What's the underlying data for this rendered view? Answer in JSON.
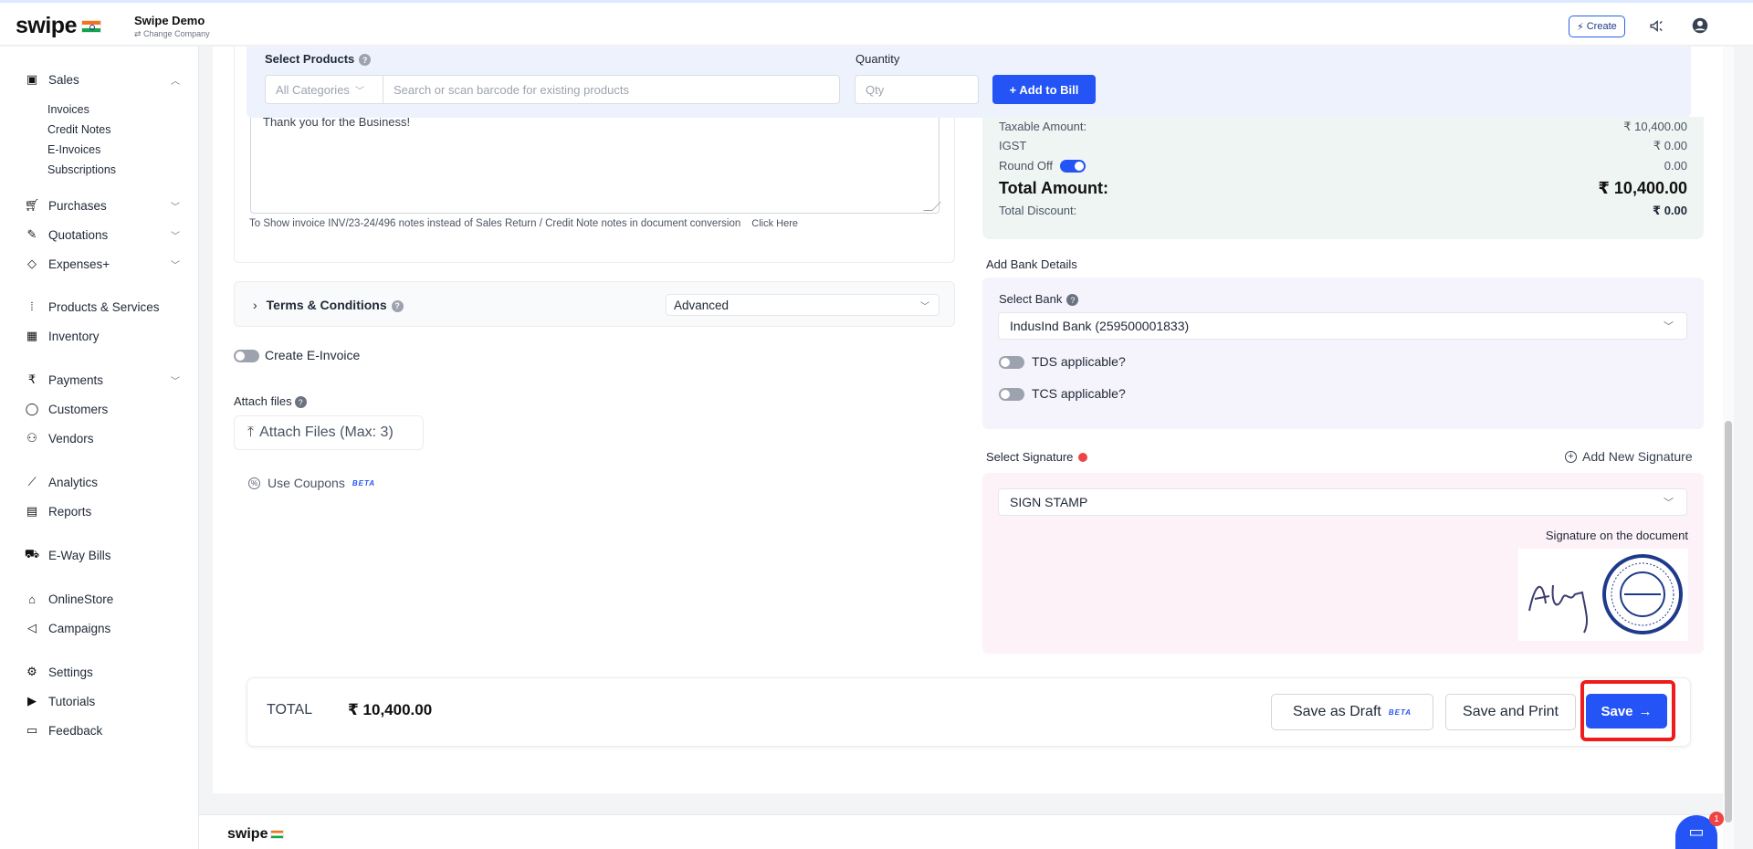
{
  "topbar": {
    "logo": "swipe",
    "company_name": "Swipe Demo",
    "change_company": "Change Company",
    "create_label": "Create"
  },
  "sidebar": {
    "sales": "Sales",
    "sales_sub": [
      "Invoices",
      "Credit Notes",
      "E-Invoices",
      "Subscriptions"
    ],
    "purchases": "Purchases",
    "quotations": "Quotations",
    "expenses": "Expenses+",
    "products": "Products & Services",
    "inventory": "Inventory",
    "payments": "Payments",
    "customers": "Customers",
    "vendors": "Vendors",
    "analytics": "Analytics",
    "reports": "Reports",
    "eway": "E-Way Bills",
    "onlinestore": "OnlineStore",
    "campaigns": "Campaigns",
    "settings": "Settings",
    "tutorials": "Tutorials",
    "feedback": "Feedback"
  },
  "products_bar": {
    "select_label": "Select Products",
    "category_placeholder": "All Categories",
    "search_placeholder": "Search or scan barcode for existing products",
    "quantity_label": "Quantity",
    "qty_placeholder": "Qty",
    "add_button": "+ Add to Bill"
  },
  "notes": {
    "text": "Thank you for the Business!",
    "hint": "To Show invoice INV/23-24/496 notes instead of Sales Return / Credit Note notes in document conversion",
    "click_here": "Click Here"
  },
  "terms": {
    "title": "Terms & Conditions",
    "mode": "Advanced"
  },
  "einvoice": {
    "label": "Create E-Invoice"
  },
  "attach": {
    "label": "Attach files",
    "button": "Attach Files (Max: 3)"
  },
  "coupons": {
    "label": "Use Coupons",
    "beta": "BETA"
  },
  "summary": {
    "taxable_label": "Taxable Amount:",
    "taxable_value": "₹ 10,400.00",
    "igst_label": "IGST",
    "igst_value": "₹ 0.00",
    "roundoff_label": "Round Off",
    "roundoff_value": "0.00",
    "total_label": "Total Amount:",
    "total_value": "₹ 10,400.00",
    "discount_label": "Total Discount:",
    "discount_value": "₹ 0.00"
  },
  "bank": {
    "section_label": "Add Bank Details",
    "select_label": "Select Bank",
    "selected_bank": "IndusInd Bank (259500001833)",
    "tds_label": "TDS applicable?",
    "tcs_label": "TCS applicable?"
  },
  "signature": {
    "section_label": "Select Signature",
    "add_new": "Add New Signature",
    "selected": "SIGN STAMP",
    "caption": "Signature on the document"
  },
  "footer": {
    "total_label": "TOTAL",
    "total_value": "₹ 10,400.00",
    "save_draft": "Save as Draft",
    "beta": "BETA",
    "save_print": "Save and Print",
    "save": "Save"
  },
  "bottom": {
    "logo": "swipe",
    "chat_badge": "1"
  },
  "colors": {
    "primary": "#2454f5",
    "highlight": "#ef1c1c",
    "summary_bg": "#eef5f3",
    "bank_bg": "#f5f3fb",
    "signature_bg": "#fdf2f8"
  }
}
